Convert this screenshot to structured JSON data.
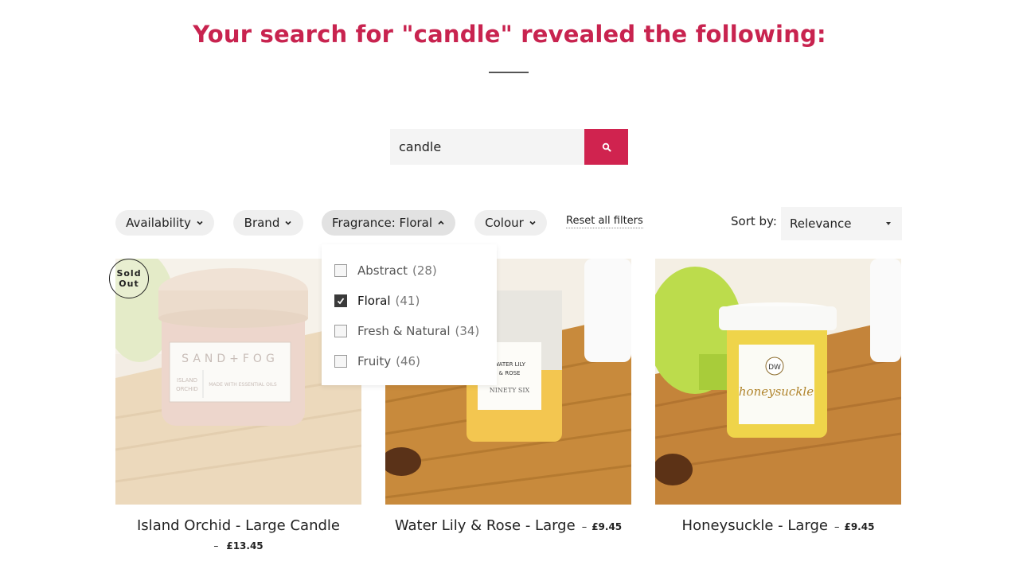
{
  "header": {
    "title": "Your search for \"candle\" revealed the following:"
  },
  "search": {
    "value": "candle",
    "button_icon": "search-icon",
    "accent_color": "#d0234f"
  },
  "filters": {
    "pills": [
      {
        "label": "Availability",
        "icon": "chevron-down-icon",
        "expanded": false
      },
      {
        "label": "Brand",
        "icon": "chevron-down-icon",
        "expanded": false
      },
      {
        "label": "Fragrance: Floral",
        "icon": "chevron-up-icon",
        "expanded": true
      },
      {
        "label": "Colour",
        "icon": "chevron-down-icon",
        "expanded": false
      }
    ],
    "reset_label": "Reset all filters",
    "sort_label": "Sort by:",
    "sort_value": "Relevance"
  },
  "fragrance_dropdown": {
    "options": [
      {
        "label": "Abstract",
        "count": "(28)",
        "checked": false
      },
      {
        "label": "Floral",
        "count": "(41)",
        "checked": true
      },
      {
        "label": "Fresh & Natural",
        "count": "(34)",
        "checked": false
      },
      {
        "label": "Fruity",
        "count": "(46)",
        "checked": false
      }
    ]
  },
  "products": [
    {
      "name": "Island Orchid - Large Candle",
      "dash": "–",
      "price": "£13.45",
      "badge": "Sold Out",
      "badge_lines": [
        "Sold",
        "Out"
      ],
      "sold_out": true
    },
    {
      "name": "Water Lily & Rose - Large",
      "dash": "–",
      "price": "£9.45",
      "sold_out": false
    },
    {
      "name": "Honeysuckle - Large",
      "dash": "–",
      "price": "£9.45",
      "sold_out": false
    }
  ]
}
